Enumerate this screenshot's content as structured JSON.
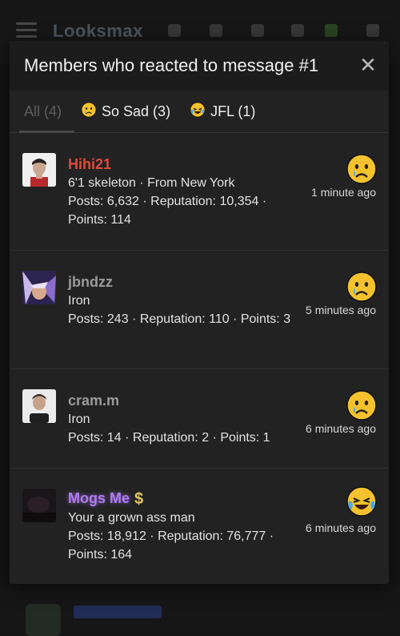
{
  "background": {
    "brand": "Looksmax"
  },
  "modal": {
    "title": "Members who reacted to message #1",
    "close_glyph": "✕"
  },
  "tabs": [
    {
      "label": "All (4)",
      "emoji": ""
    },
    {
      "label": "So Sad (3)",
      "emoji": "😢"
    },
    {
      "label": "JFL (1)",
      "emoji": "😭"
    }
  ],
  "members": [
    {
      "username": "Hihi21",
      "username_color": "#e0483d",
      "title": "6'1 skeleton · From New York",
      "stats": "Posts: 6,632 · Reputation: 10,354 · Points: 114",
      "reaction": "sad",
      "time": "1 minute ago"
    },
    {
      "username": "jbndzz",
      "username_color": "#9a9a9a",
      "title": "Iron",
      "stats": "Posts: 243 · Reputation: 110 · Points: 3",
      "reaction": "sad",
      "time": "5 minutes ago"
    },
    {
      "username": "cram.m",
      "username_color": "#9a9a9a",
      "title": "Iron",
      "stats": "Posts: 14 · Reputation: 2 · Points: 1",
      "reaction": "sad",
      "time": "6 minutes ago"
    },
    {
      "username": "Mogs Me",
      "username_color": "#b07cf5",
      "title": "Your a grown ass man",
      "stats": "Posts: 18,912 · Reputation: 76,777 · Points: 164",
      "reaction": "jfl",
      "time": "6 minutes ago",
      "badge": "$"
    }
  ],
  "colors": {
    "modal_bg": "#222222",
    "header_bg": "#1c1c1c",
    "emoji_yellow": "#f5c22e",
    "tear_blue": "#49a9f5"
  }
}
